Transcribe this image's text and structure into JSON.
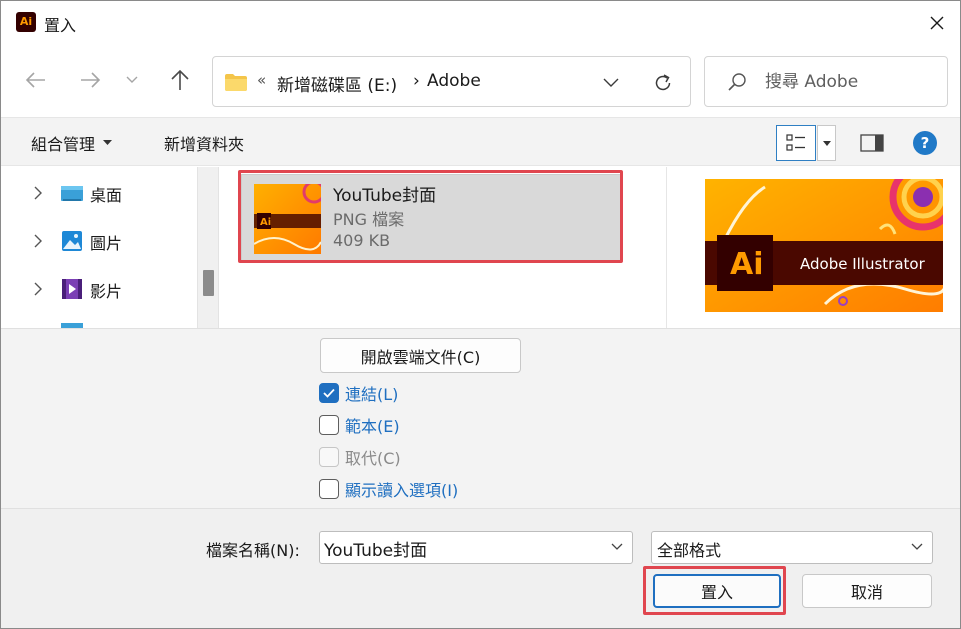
{
  "window": {
    "title": "置入",
    "app_icon_text": "Ai",
    "icons": {
      "close": "close-icon"
    }
  },
  "nav": {
    "icons": [
      "back-arrow-icon",
      "forward-arrow-icon",
      "recent-chevron-icon",
      "up-arrow-icon"
    ],
    "address": {
      "prefix": "«",
      "segments": [
        "新增磁碟區 (E:)",
        "Adobe"
      ],
      "separator": "›"
    },
    "search_placeholder": "搜尋 Adobe"
  },
  "commands": {
    "organize": "組合管理",
    "new_folder": "新增資料夾"
  },
  "sidebar": {
    "items": [
      {
        "label": "桌面",
        "icon": "desktop-icon"
      },
      {
        "label": "圖片",
        "icon": "pictures-icon"
      },
      {
        "label": "影片",
        "icon": "videos-icon"
      }
    ]
  },
  "files": [
    {
      "name": "YouTube封面",
      "type": "PNG 檔案",
      "size": "409 KB",
      "selected": true
    }
  ],
  "preview": {
    "app_name": "Adobe Illustrator",
    "logo_text": "Ai"
  },
  "options": {
    "cloud_button": "開啟雲端文件(C)",
    "checkboxes": [
      {
        "label": "連結(L)",
        "checked": true,
        "disabled": false
      },
      {
        "label": "範本(E)",
        "checked": false,
        "disabled": false
      },
      {
        "label": "取代(C)",
        "checked": false,
        "disabled": true
      },
      {
        "label": "顯示讀入選項(I)",
        "checked": false,
        "disabled": false
      }
    ]
  },
  "footer": {
    "filename_label": "檔案名稱(N):",
    "filename_value": "YouTube封面",
    "filetype_value": "全部格式",
    "place_button": "置入",
    "cancel_button": "取消"
  },
  "colors": {
    "accent": "#1f6fc0",
    "highlight": "#e0464f",
    "illustrator_orange": "#ff9a00",
    "illustrator_dark": "#330000"
  }
}
